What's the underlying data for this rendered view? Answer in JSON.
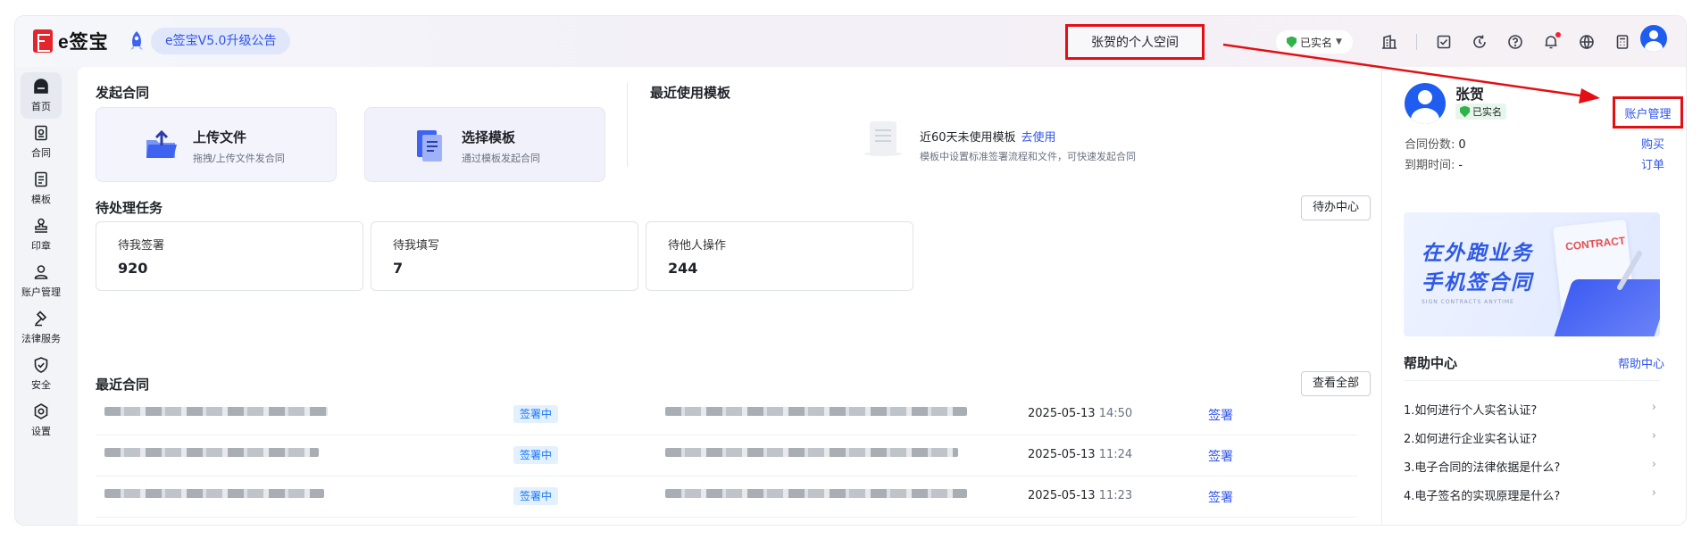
{
  "header": {
    "logo_text": "e签宝",
    "notice": "e签宝V5.0升级公告",
    "space": "张贺的个人空间",
    "verify": "已实名",
    "icons": [
      "building-icon",
      "checkbox-icon",
      "refresh-icon",
      "help-icon",
      "bell-icon",
      "globe-icon",
      "calculator-icon"
    ]
  },
  "sidebar": {
    "items": [
      {
        "label": "首页",
        "icon": "home-icon"
      },
      {
        "label": "合同",
        "icon": "contract-icon"
      },
      {
        "label": "模板",
        "icon": "template-icon"
      },
      {
        "label": "印章",
        "icon": "seal-icon"
      },
      {
        "label": "账户管理",
        "icon": "user-icon"
      },
      {
        "label": "法律服务",
        "icon": "gavel-icon"
      },
      {
        "label": "安全",
        "icon": "shield-icon"
      },
      {
        "label": "设置",
        "icon": "gear-icon"
      }
    ]
  },
  "launch": {
    "title": "发起合同",
    "upload_title": "上传文件",
    "upload_desc": "拖拽/上传文件发合同",
    "template_title": "选择模板",
    "template_desc": "通过模板发起合同"
  },
  "recent_templates": {
    "title": "最近使用模板",
    "empty_text": "近60天未使用模板",
    "empty_link": "去使用",
    "empty_desc": "模板中设置标准签署流程和文件，可快速发起合同"
  },
  "tasks": {
    "title": "待处理任务",
    "center_button": "待办中心",
    "cards": [
      {
        "label": "待我签署",
        "value": "920"
      },
      {
        "label": "待我填写",
        "value": "7"
      },
      {
        "label": "待他人操作",
        "value": "244"
      }
    ]
  },
  "recent_contracts": {
    "title": "最近合同",
    "view_all": "查看全部",
    "rows": [
      {
        "status": "签署中",
        "date": "2025-05-13",
        "time": "14:50",
        "action": "签署"
      },
      {
        "status": "签署中",
        "date": "2025-05-13",
        "time": "11:24",
        "action": "签署"
      },
      {
        "status": "签署中",
        "date": "2025-05-13",
        "time": "11:23",
        "action": "签署"
      }
    ]
  },
  "profile": {
    "name": "张贺",
    "verify": "已实名",
    "account_manage": "账户管理",
    "contract_count_label": "合同份数:",
    "contract_count": "0",
    "buy": "购买",
    "expire_label": "到期时间:",
    "expire_value": "-",
    "orders": "订单"
  },
  "banner": {
    "line1": "在外跑业务",
    "line2": "手机签合同",
    "line3": "SIGN CONTRACTS ANYTIME",
    "contract_word": "CONTRACT"
  },
  "help": {
    "title": "帮助中心",
    "link": "帮助中心",
    "items": [
      "1.如何进行个人实名认证?",
      "2.如何进行企业实名认证?",
      "3.电子合同的法律依据是什么?",
      "4.电子签名的实现原理是什么?"
    ]
  },
  "colors": {
    "accent": "#2f54eb",
    "annotation_red": "#e30f13",
    "verified_green": "#2fb34a",
    "status_blue": "#1677ff"
  }
}
